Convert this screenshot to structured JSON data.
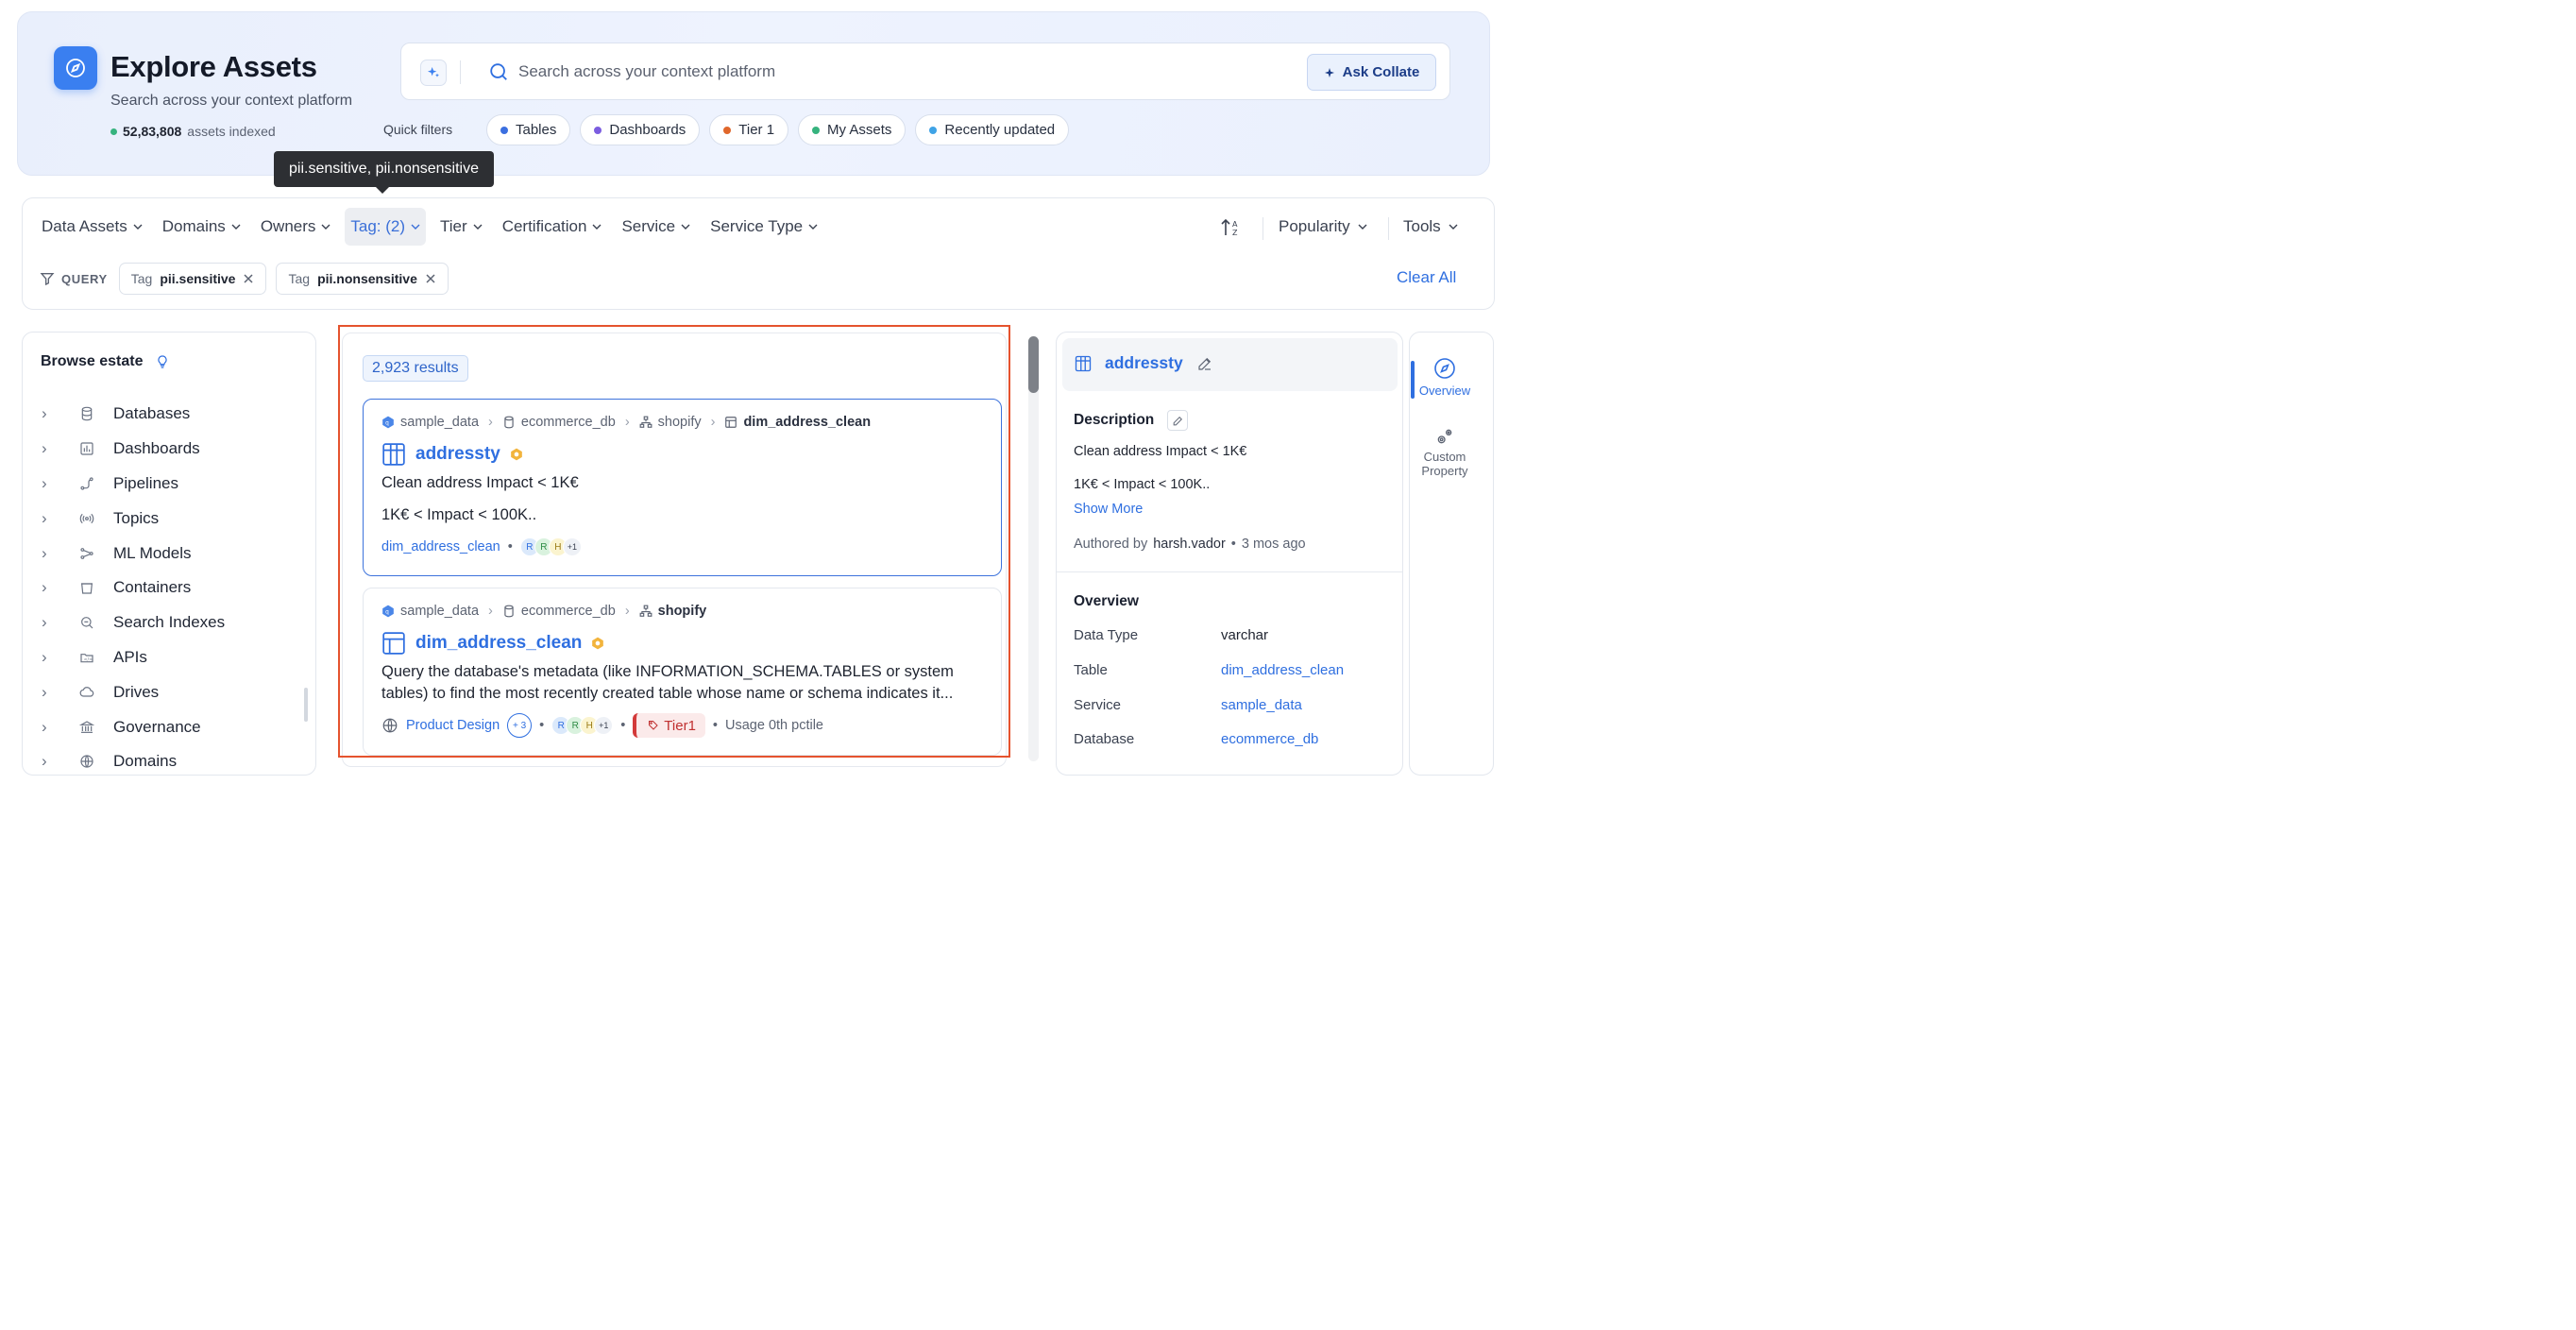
{
  "hero": {
    "title": "Explore Assets",
    "subtitle": "Search across your context platform",
    "asset_count": "52,83,808",
    "asset_count_suffix": "assets indexed"
  },
  "search": {
    "placeholder": "Search across your context platform",
    "ask_label": "Ask Collate"
  },
  "quick_filters": {
    "label": "Quick filters",
    "items": [
      {
        "label": "Tables",
        "color": "#3b6fe0"
      },
      {
        "label": "Dashboards",
        "color": "#7b5de0"
      },
      {
        "label": "Tier 1",
        "color": "#e0672b"
      },
      {
        "label": "My Assets",
        "color": "#36b37e"
      },
      {
        "label": "Recently updated",
        "color": "#3fa3e6"
      }
    ]
  },
  "tooltip": "pii.sensitive, pii.nonsensitive",
  "filters": {
    "items": [
      "Data Assets",
      "Domains",
      "Owners",
      "Tag: (2)",
      "Tier",
      "Certification",
      "Service",
      "Service Type"
    ],
    "sort_label": "Popularity",
    "tools_label": "Tools"
  },
  "query": {
    "label": "QUERY",
    "chips": [
      {
        "key": "Tag",
        "value": "pii.sensitive"
      },
      {
        "key": "Tag",
        "value": "pii.nonsensitive"
      }
    ],
    "clear_all": "Clear All"
  },
  "browse": {
    "title": "Browse estate",
    "items": [
      {
        "label": "Databases",
        "icon": "database-icon"
      },
      {
        "label": "Dashboards",
        "icon": "dashboard-icon"
      },
      {
        "label": "Pipelines",
        "icon": "pipeline-icon"
      },
      {
        "label": "Topics",
        "icon": "topic-icon"
      },
      {
        "label": "ML Models",
        "icon": "ml-model-icon"
      },
      {
        "label": "Containers",
        "icon": "container-icon"
      },
      {
        "label": "Search Indexes",
        "icon": "search-index-icon"
      },
      {
        "label": "APIs",
        "icon": "api-icon"
      },
      {
        "label": "Drives",
        "icon": "drive-icon"
      },
      {
        "label": "Governance",
        "icon": "governance-icon"
      },
      {
        "label": "Domains",
        "icon": "domain-icon"
      }
    ]
  },
  "results": {
    "count": "2,923 results",
    "cards": [
      {
        "crumbs": [
          "sample_data",
          "ecommerce_db",
          "shopify",
          "dim_address_clean"
        ],
        "title": "addressty",
        "desc1": "Clean address Impact < 1K€",
        "desc2": "1K€ < Impact < 100K..",
        "parent": "dim_address_clean",
        "avatars": [
          "R",
          "R",
          "H"
        ],
        "more": "+1"
      },
      {
        "crumbs": [
          "sample_data",
          "ecommerce_db",
          "shopify"
        ],
        "title": "dim_address_clean",
        "desc": "Query the database's metadata (like INFORMATION_SCHEMA.TABLES or system tables) to find the most recently created table whose name or schema indicates it...",
        "domain": "Product Design",
        "domain_more": "+ 3",
        "avatars": [
          "R",
          "R",
          "H"
        ],
        "more": "+1",
        "tier": "Tier1",
        "usage": "Usage 0th pctile"
      }
    ]
  },
  "details": {
    "title": "addressty",
    "description_label": "Description",
    "desc1": "Clean address Impact < 1K€",
    "desc2": "1K€ < Impact < 100K..",
    "show_more": "Show More",
    "authored_prefix": "Authored by",
    "author": "harsh.vador",
    "authored_time": "3 mos ago",
    "overview_label": "Overview",
    "props": [
      {
        "key": "Data Type",
        "value": "varchar",
        "link": false
      },
      {
        "key": "Table",
        "value": "dim_address_clean",
        "link": true
      },
      {
        "key": "Service",
        "value": "sample_data",
        "link": true
      },
      {
        "key": "Database",
        "value": "ecommerce_db",
        "link": true
      }
    ]
  },
  "rail": {
    "overview": "Overview",
    "custom_property": "Custom Property"
  },
  "colors": {
    "accent": "#2f6fe0",
    "highlight_outline": "#e5532e"
  }
}
